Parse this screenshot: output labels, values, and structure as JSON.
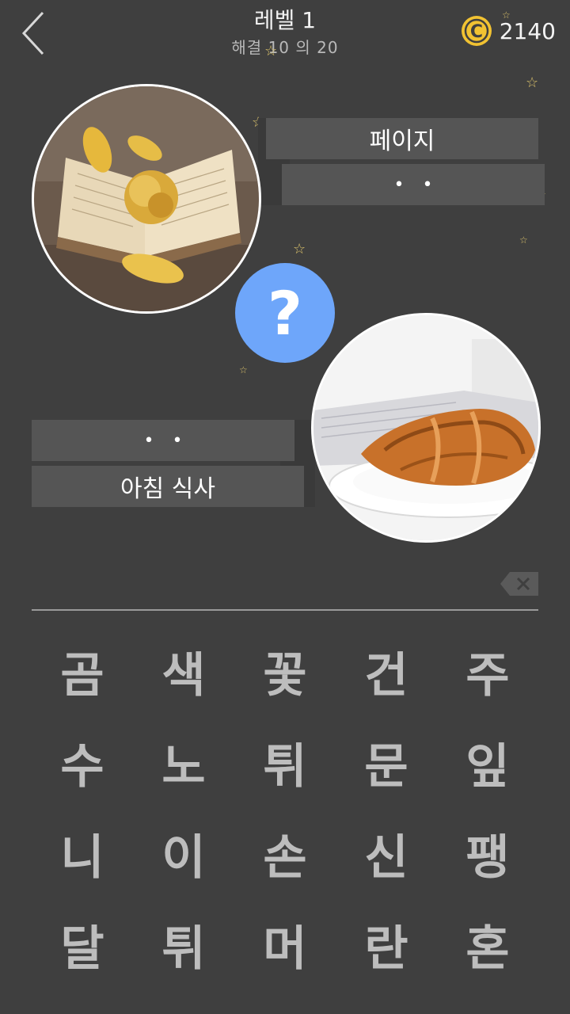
{
  "header": {
    "title": "레벨 1",
    "progress": "해결 10 의 20",
    "coins": "2140"
  },
  "clues": {
    "top_word": "페이지",
    "top_hidden": "• •",
    "bottom_hidden": "• •",
    "bottom_word": "아침 식사"
  },
  "question_mark": "?",
  "delete_symbol": "✕",
  "letters": [
    "곰",
    "색",
    "꽃",
    "건",
    "주",
    "수",
    "노",
    "튀",
    "문",
    "잎",
    "니",
    "이",
    "손",
    "신",
    "팽",
    "달",
    "튀",
    "머",
    "란",
    "혼"
  ],
  "colors": {
    "background": "#3f3f3f",
    "bar": "#555555",
    "accent_blue": "#6ea6fa",
    "coin_gold": "#f1c232"
  }
}
